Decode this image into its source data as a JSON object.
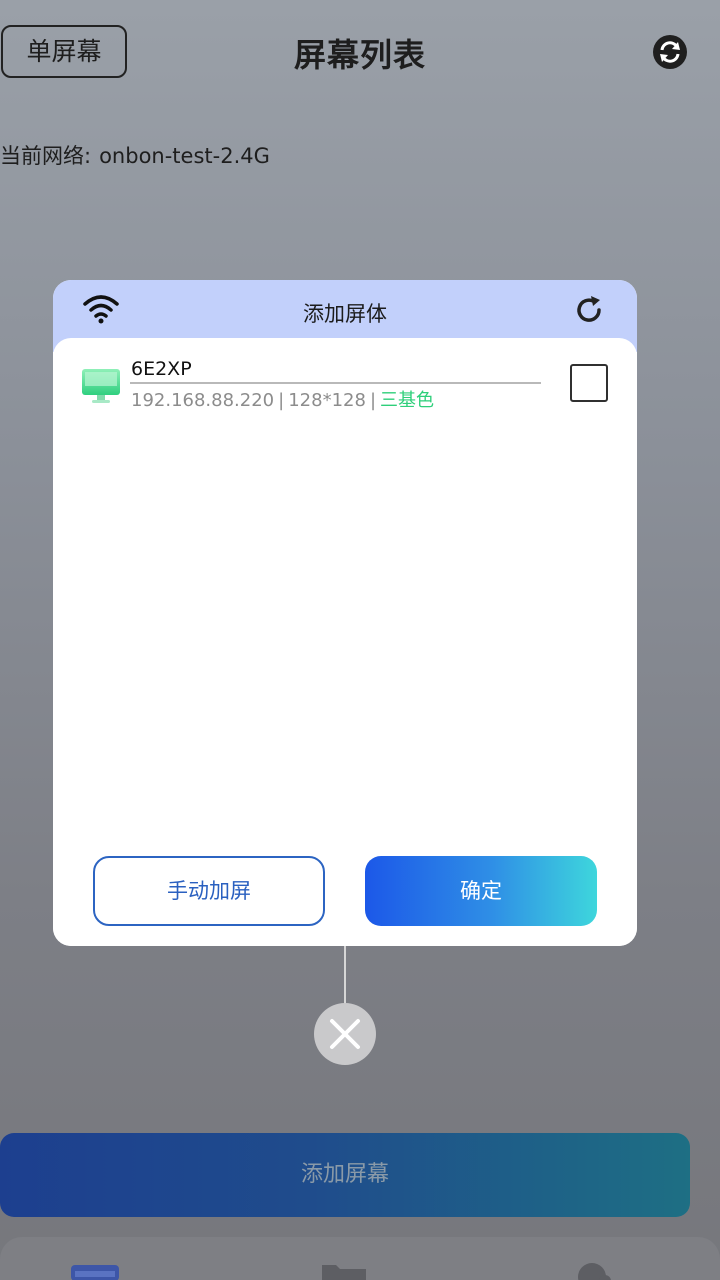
{
  "header": {
    "single_screen_label": "单屏幕",
    "title": "屏幕列表",
    "sync_icon": "sync-icon"
  },
  "network": {
    "label": "当前网络:",
    "ssid": "onbon-test-2.4G"
  },
  "modal": {
    "title": "添加屏体",
    "wifi_icon": "wifi-icon",
    "refresh_icon": "refresh-icon",
    "devices": [
      {
        "name": "6E2XP",
        "ip": "192.168.88.220",
        "resolution": "128*128",
        "color_type": "三基色",
        "checked": false
      }
    ],
    "manual_add_label": "手动加屏",
    "confirm_label": "确定",
    "close_icon": "close-icon"
  },
  "footer": {
    "add_screen_label": "添加屏幕"
  },
  "colors": {
    "modal_header": "#c2d0fb",
    "confirm_gradient_start": "#1c58e8",
    "confirm_gradient_end": "#3ed6dc",
    "color_type_text": "#2ecf7a",
    "manual_border": "#2c64c2"
  }
}
